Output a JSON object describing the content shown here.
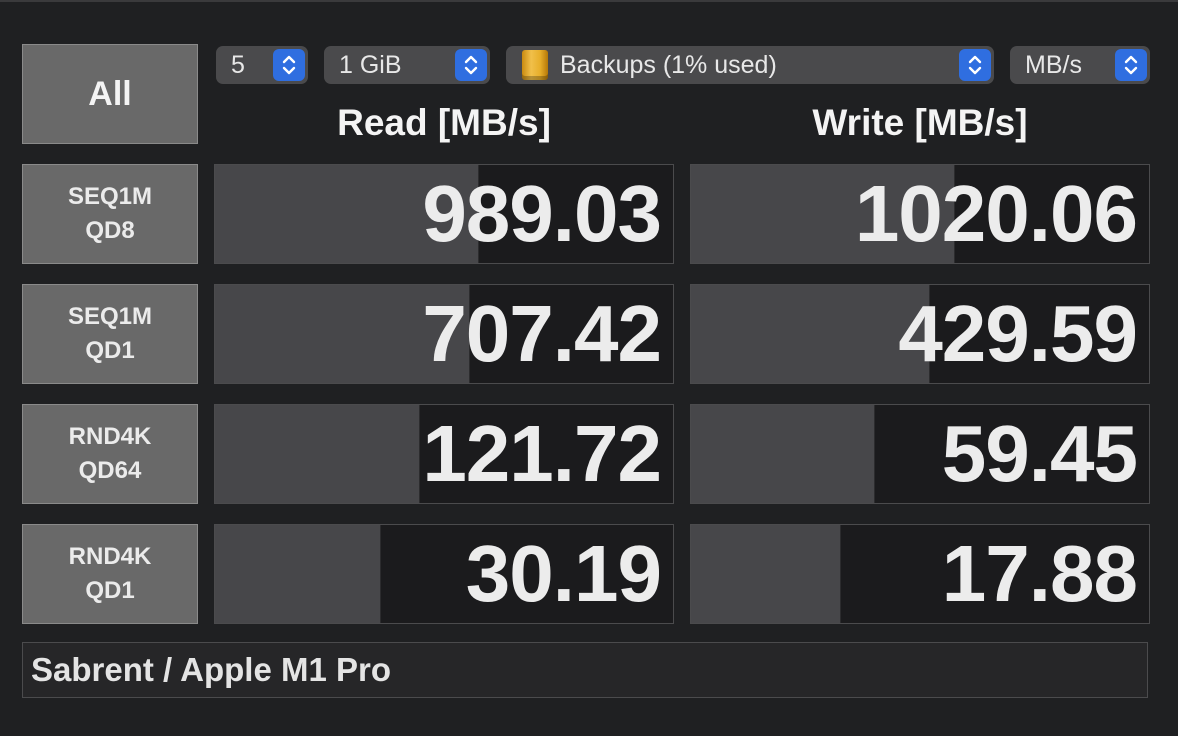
{
  "toolbar": {
    "all_label": "All",
    "count": "5",
    "size": "1 GiB",
    "drive": "Backups (1% used)",
    "unit": "MB/s"
  },
  "headers": {
    "read": "Read [MB/s]",
    "write": "Write [MB/s]"
  },
  "rows": [
    {
      "line1": "SEQ1M",
      "line2": "QD8",
      "read": "989.03",
      "write": "1020.06",
      "read_fill": 0.575,
      "write_fill": 0.575
    },
    {
      "line1": "SEQ1M",
      "line2": "QD1",
      "read": "707.42",
      "write": "429.59",
      "read_fill": 0.555,
      "write_fill": 0.52
    },
    {
      "line1": "RND4K",
      "line2": "QD64",
      "read": "121.72",
      "write": "59.45",
      "read_fill": 0.445,
      "write_fill": 0.4
    },
    {
      "line1": "RND4K",
      "line2": "QD1",
      "read": "30.19",
      "write": "17.88",
      "read_fill": 0.36,
      "write_fill": 0.325
    }
  ],
  "comment": "Sabrent / Apple M1 Pro",
  "colors": {
    "background": "#1f2022",
    "button": "#696969",
    "bar": "#47474a",
    "stepper_accent": "#2f6ee0"
  },
  "icons": {
    "stepper": "chevron-up-down-icon",
    "drive": "external-drive-icon"
  }
}
